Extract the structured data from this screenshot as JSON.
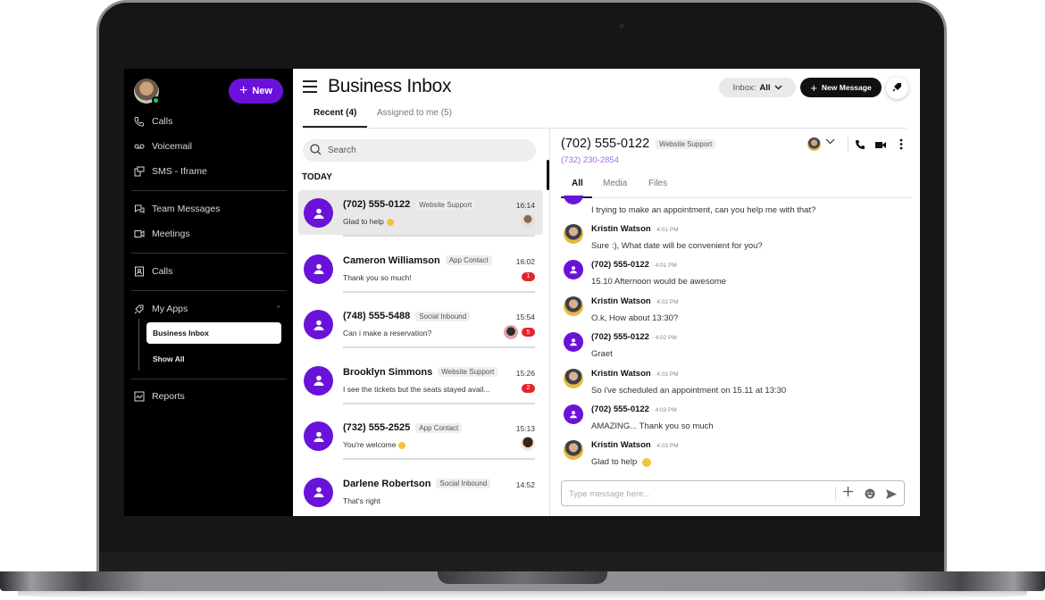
{
  "sidebar": {
    "new_label": "New",
    "items": [
      {
        "label": "Calls",
        "icon": "phone-icon"
      },
      {
        "label": "Voicemail",
        "icon": "voicemail-icon"
      },
      {
        "label": "SMS - Iframe",
        "icon": "sms-iframe-icon"
      },
      {
        "label": "Team Messages",
        "icon": "chat-bubbles-icon"
      },
      {
        "label": "Meetings",
        "icon": "video-icon"
      },
      {
        "label": "Calls",
        "icon": "contact-card-icon"
      },
      {
        "label": "My Apps",
        "icon": "rocket-icon"
      },
      {
        "label": "Reports",
        "icon": "chart-icon"
      }
    ],
    "my_apps": {
      "active": "Business Inbox",
      "show_all": "Show All"
    }
  },
  "header": {
    "title": "Business Inbox",
    "inbox_filter_prefix": "Inbox:",
    "inbox_filter_value": "All",
    "new_message_label": "New Message",
    "tabs": [
      {
        "label": "Recent (4)"
      },
      {
        "label": "Assigned to me (5)"
      }
    ]
  },
  "list": {
    "search_placeholder": "Search",
    "section": "TODAY",
    "conversations": [
      {
        "name": "(702) 555-0122",
        "tag": "Website Support",
        "time": "16:14",
        "preview": "Glad to help",
        "emoji": true,
        "badge": "",
        "assignee": true
      },
      {
        "name": "Cameron Williamson",
        "tag": "App Contact",
        "time": "16:02",
        "preview": "Thank you so much!",
        "emoji": false,
        "badge": "1",
        "assignee": false
      },
      {
        "name": "(748) 555-5488",
        "tag": "Social Inbound",
        "time": "15:54",
        "preview": "Can i make a reservation?",
        "emoji": false,
        "badge": "5",
        "assignee": true
      },
      {
        "name": "Brooklyn Simmons",
        "tag": "Website Support",
        "time": "15:26",
        "preview": "I see the tickets but the seats stayed avail...",
        "emoji": false,
        "badge": "2",
        "assignee": false
      },
      {
        "name": "(732) 555-2525",
        "tag": "App Contact",
        "time": "15:13",
        "preview": "You're welcome",
        "emoji": true,
        "badge": "",
        "assignee": true
      },
      {
        "name": "Darlene Robertson",
        "tag": "Social Inbound",
        "time": "14:52",
        "preview": "That's right",
        "emoji": false,
        "badge": "",
        "assignee": false
      }
    ]
  },
  "chat": {
    "name": "(702) 555-0122",
    "tag": "Website Support",
    "sub_number": "(732) 230-2854",
    "tabs": [
      {
        "label": "All"
      },
      {
        "label": "Media"
      },
      {
        "label": "Files"
      }
    ],
    "first_message": "I trying to make an appointment, can you help me with that?",
    "messages": [
      {
        "sender": "Kristin Watson",
        "type": "agent",
        "time": "4:01 PM",
        "text": "Sure :), What date will be convenient for you?"
      },
      {
        "sender": "(702) 555-0122",
        "type": "contact",
        "time": "4:01 PM",
        "text": "15.10 Afternoon would be awesome"
      },
      {
        "sender": "Kristin Watson",
        "type": "agent",
        "time": "4:02 PM",
        "text": "O.k, How about 13:30?"
      },
      {
        "sender": "(702) 555-0122",
        "type": "contact",
        "time": "4:02 PM",
        "text": "Graet"
      },
      {
        "sender": "Kristin Watson",
        "type": "agent",
        "time": "4:03 PM",
        "text": "So i've scheduled an appointment on 15.11 at 13:30"
      },
      {
        "sender": "(702) 555-0122",
        "type": "contact",
        "time": "4:03 PM",
        "text": "AMAZING... Thank you so much"
      },
      {
        "sender": "Kristin Watson",
        "type": "agent",
        "time": "4:03 PM",
        "text": "Glad to help",
        "emoji": true
      }
    ],
    "composer_placeholder": "Type message here..."
  },
  "colors": {
    "brand": "#6a12d9",
    "badge": "#e0262b",
    "online": "#19c37d"
  }
}
